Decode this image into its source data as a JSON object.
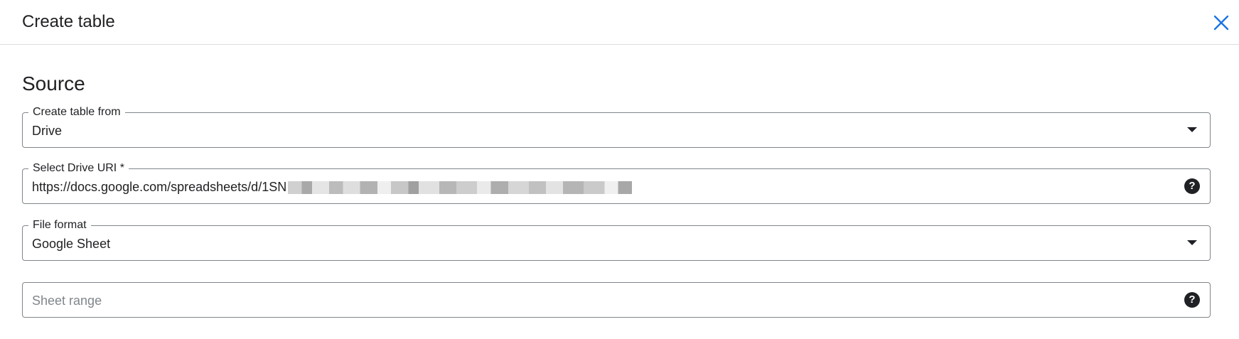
{
  "dialog": {
    "title": "Create table",
    "close_icon": "close-icon",
    "accent_color": "#1a73e8"
  },
  "source": {
    "section_title": "Source",
    "create_table_from": {
      "label": "Create table from",
      "value": "Drive"
    },
    "drive_uri": {
      "label": "Select Drive URI *",
      "value": "https://docs.google.com/spreadsheets/d/1SN"
    },
    "file_format": {
      "label": "File format",
      "value": "Google Sheet"
    },
    "sheet_range": {
      "placeholder": "Sheet range"
    }
  }
}
